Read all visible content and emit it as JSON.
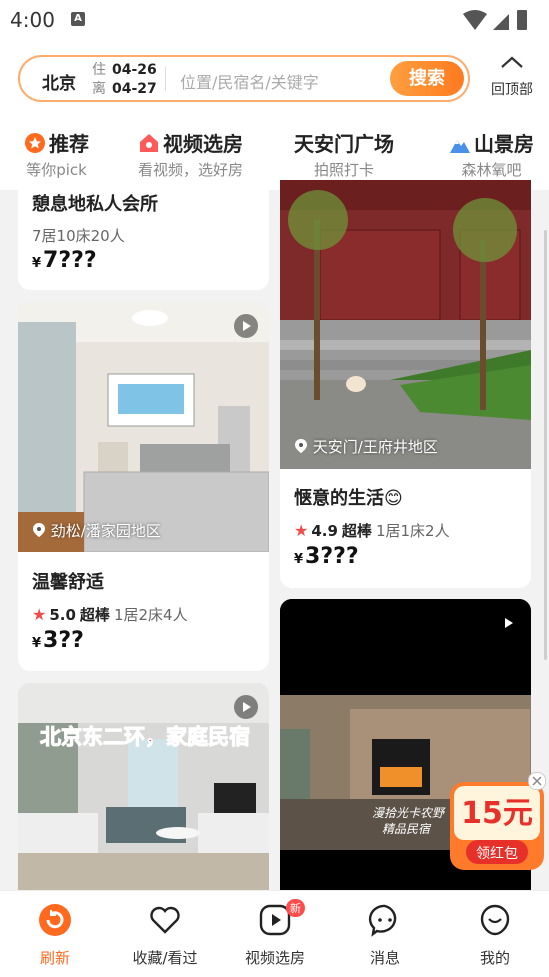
{
  "status": {
    "time": "4:00",
    "notif_icon": "A"
  },
  "search": {
    "city": "北京",
    "checkin_label": "住",
    "checkin": "04-26",
    "checkout_label": "离",
    "checkout": "04-27",
    "placeholder": "位置/民宿名/关键字",
    "button": "搜索"
  },
  "back_to_top": "回顶部",
  "tabs": [
    {
      "title": "推荐",
      "sub": "等你pick"
    },
    {
      "title": "视频选房",
      "sub": "看视频，选好房"
    },
    {
      "title": "天安门广场",
      "sub": "拍照打卡"
    },
    {
      "title": "山景房",
      "sub": "森林氧吧"
    }
  ],
  "cards": {
    "c1": {
      "title": "憩息地私人会所",
      "meta": "7居10床20人",
      "currency": "¥",
      "price": "7???"
    },
    "c2": {
      "location": "劲松/潘家园地区",
      "title": "温馨舒适",
      "score": "5.0",
      "good": "超棒",
      "meta": "1居2床4人",
      "currency": "¥",
      "price": "3??"
    },
    "c3": {
      "overlay": "北京东二环，家庭民宿"
    },
    "c4": {
      "location": "天安门/王府井地区",
      "title": "惬意的生活😊",
      "score": "4.9",
      "good": "超棒",
      "meta": "1居1床2人",
      "currency": "¥",
      "price": "3???"
    },
    "c5": {
      "caption1": "漫拾光卡农野",
      "caption2": "精品民宿"
    }
  },
  "promo": {
    "amount": "15元",
    "label": "领红包"
  },
  "nav": [
    {
      "label": "刷新"
    },
    {
      "label": "收藏/看过"
    },
    {
      "label": "视频选房",
      "badge": "新"
    },
    {
      "label": "消息"
    },
    {
      "label": "我的"
    }
  ],
  "colors": {
    "accent": "#ff6a1f",
    "star": "#f24b4b"
  }
}
